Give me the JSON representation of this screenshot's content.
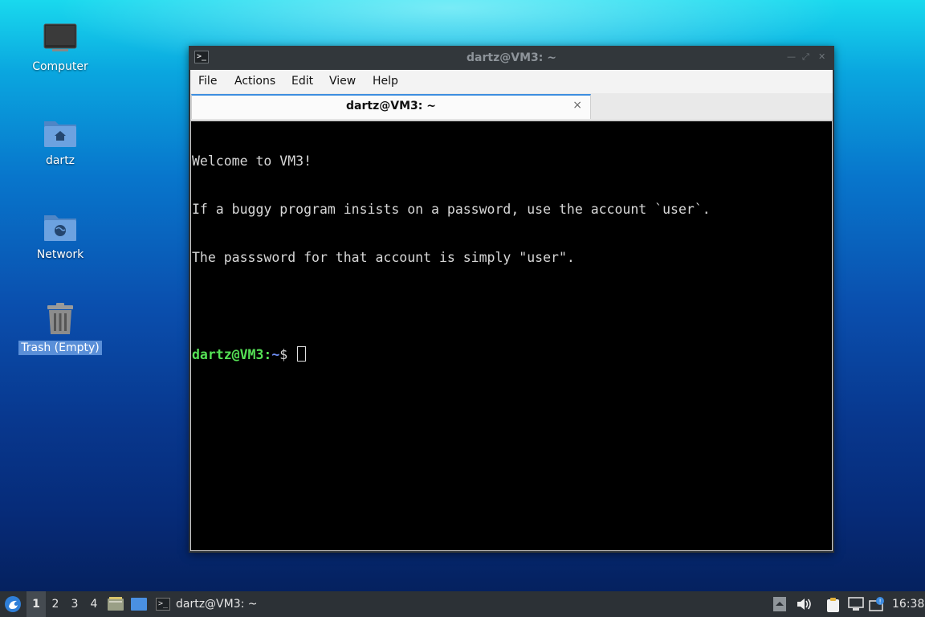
{
  "desktop": {
    "icons": [
      {
        "label": "Computer"
      },
      {
        "label": "dartz"
      },
      {
        "label": "Network"
      },
      {
        "label": "Trash (Empty)"
      }
    ]
  },
  "window": {
    "title": "dartz@VM3: ~",
    "menu": [
      "File",
      "Actions",
      "Edit",
      "View",
      "Help"
    ],
    "tab": {
      "label": "dartz@VM3: ~",
      "close": "×"
    },
    "terminal": {
      "lines": [
        "Welcome to VM3!",
        "If a buggy program insists on a password, use the account `user`.",
        "The passsword for that account is simply \"user\"."
      ],
      "prompt_user": "dartz@VM3",
      "prompt_sep": ":",
      "prompt_path": "~",
      "prompt_symbol": "$"
    }
  },
  "taskbar": {
    "workspaces": [
      "1",
      "2",
      "3",
      "4"
    ],
    "active_workspace": "1",
    "task_label": "dartz@VM3: ~",
    "clock": "16:38"
  },
  "colors": {
    "prompt_user": "#55e055",
    "prompt_path": "#6f8ff5",
    "tab_accent": "#3d8ee0",
    "selection": "#5a8fd8"
  },
  "icons": [
    "start-menu-icon",
    "file-manager-icon",
    "show-desktop-icon",
    "terminal-icon",
    "tray-arrow-icon",
    "volume-icon",
    "clipboard-icon",
    "network-icon",
    "update-icon"
  ]
}
